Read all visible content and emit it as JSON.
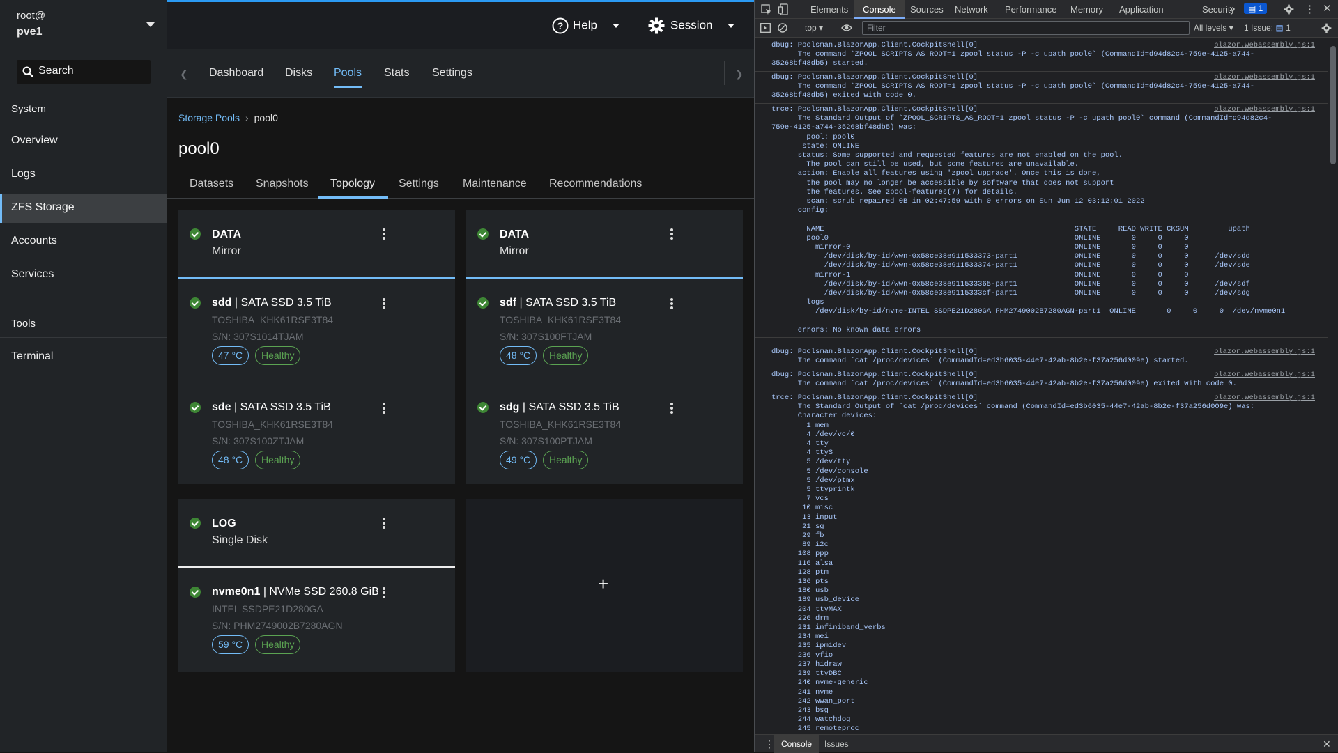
{
  "sidebar": {
    "user": "root@",
    "host": "pve1",
    "search_label": "Search",
    "system_heading": "System",
    "items": [
      {
        "label": "Overview"
      },
      {
        "label": "Logs"
      },
      {
        "label": "ZFS Storage",
        "active": true
      },
      {
        "label": "Accounts"
      },
      {
        "label": "Services"
      }
    ],
    "tools_heading": "Tools",
    "tools_items": [
      {
        "label": "Terminal"
      }
    ]
  },
  "masthead": {
    "help_label": "Help",
    "session_label": "Session"
  },
  "tabs": [
    "Dashboard",
    "Disks",
    "Pools",
    "Stats",
    "Settings"
  ],
  "active_tab": "Pools",
  "breadcrumb": {
    "parent": "Storage Pools",
    "current": "pool0"
  },
  "pool_title": "pool0",
  "subtabs": [
    "Datasets",
    "Snapshots",
    "Topology",
    "Settings",
    "Maintenance",
    "Recommendations"
  ],
  "active_subtab": "Topology",
  "topology": {
    "vdev_left": {
      "type": "DATA",
      "layout": "Mirror"
    },
    "vdev_right": {
      "type": "DATA",
      "layout": "Mirror"
    },
    "vdev_log": {
      "type": "LOG",
      "layout": "Single Disk"
    },
    "disks": {
      "sdd": {
        "name": "sdd",
        "desc": " | SATA SSD 3.5 TiB",
        "model": "TOSHIBA_KHK61RSE3T84",
        "serial": "S/N: 307S1014TJAM",
        "temp": "47 °C",
        "health": "Healthy"
      },
      "sdf": {
        "name": "sdf",
        "desc": " | SATA SSD 3.5 TiB",
        "model": "TOSHIBA_KHK61RSE3T84",
        "serial": "S/N: 307S100FTJAM",
        "temp": "48 °C",
        "health": "Healthy"
      },
      "sde": {
        "name": "sde",
        "desc": " | SATA SSD 3.5 TiB",
        "model": "TOSHIBA_KHK61RSE3T84",
        "serial": "S/N: 307S100ZTJAM",
        "temp": "48 °C",
        "health": "Healthy"
      },
      "sdg": {
        "name": "sdg",
        "desc": " | SATA SSD 3.5 TiB",
        "model": "TOSHIBA_KHK61RSE3T84",
        "serial": "S/N: 307S100PTJAM",
        "temp": "49 °C",
        "health": "Healthy"
      },
      "nvme": {
        "name": "nvme0n1",
        "desc": " | NVMe SSD 260.8 GiB",
        "model": "INTEL SSDPE21D280GA",
        "serial": "S/N: PHM2749002B7280AGN",
        "temp": "59 °C",
        "health": "Healthy"
      }
    },
    "add_label": "+"
  },
  "devtools": {
    "tabs": [
      "Elements",
      "Console",
      "Sources",
      "Network",
      "Performance",
      "Memory",
      "Application",
      "Security"
    ],
    "active_tab": "Console",
    "messages_badge": "1",
    "context": "top",
    "filter_placeholder": "Filter",
    "levels": "All levels",
    "issues": "1 Issue:",
    "issues_count": "1",
    "source_link": "blazor.webassembly.js:1",
    "logs": [
      "dbug: Poolsman.BlazorApp.Client.CockpitShell[0]\n      The command `ZPOOL_SCRIPTS_AS_ROOT=1 zpool status -P -c upath pool0` (CommandId=d94d82c4-759e-4125-a744-\n35268bf48db5) started.",
      "dbug: Poolsman.BlazorApp.Client.CockpitShell[0]\n      The command `ZPOOL_SCRIPTS_AS_ROOT=1 zpool status -P -c upath pool0` (CommandId=d94d82c4-759e-4125-a744-\n35268bf48db5) exited with code 0.",
      "trce: Poolsman.BlazorApp.Client.CockpitShell[0]\n      The Standard Output of `ZPOOL_SCRIPTS_AS_ROOT=1 zpool status -P -c upath pool0` command (CommandId=d94d82c4-\n759e-4125-a744-35268bf48db5) was:\n        pool: pool0\n       state: ONLINE\n      status: Some supported and requested features are not enabled on the pool.\n        The pool can still be used, but some features are unavailable.\n      action: Enable all features using 'zpool upgrade'. Once this is done,\n        the pool may no longer be accessible by software that does not support\n        the features. See zpool-features(7) for details.\n        scan: scrub repaired 0B in 02:47:59 with 0 errors on Sun Jun 12 03:12:01 2022\n      config:\n\n        NAME                                                         STATE     READ WRITE CKSUM         upath\n        pool0                                                        ONLINE       0     0     0\n          mirror-0                                                   ONLINE       0     0     0\n            /dev/disk/by-id/wwn-0x58ce38e911533373-part1             ONLINE       0     0     0      /dev/sdd\n            /dev/disk/by-id/wwn-0x58ce38e911533374-part1             ONLINE       0     0     0      /dev/sde\n          mirror-1                                                   ONLINE       0     0     0\n            /dev/disk/by-id/wwn-0x58ce38e911533365-part1             ONLINE       0     0     0      /dev/sdf\n            /dev/disk/by-id/wwn-0x58ce38e9115333cf-part1             ONLINE       0     0     0      /dev/sdg\n        logs\n          /dev/disk/by-id/nvme-INTEL_SSDPE21D280GA_PHM2749002B7280AGN-part1  ONLINE       0     0     0  /dev/nvme0n1\n\n      errors: No known data errors\n",
      "dbug: Poolsman.BlazorApp.Client.CockpitShell[0]\n      The command `cat /proc/devices` (CommandId=ed3b6035-44e7-42ab-8b2e-f37a256d009e) started.",
      "dbug: Poolsman.BlazorApp.Client.CockpitShell[0]\n      The command `cat /proc/devices` (CommandId=ed3b6035-44e7-42ab-8b2e-f37a256d009e) exited with code 0.",
      "trce: Poolsman.BlazorApp.Client.CockpitShell[0]\n      The Standard Output of `cat /proc/devices` command (CommandId=ed3b6035-44e7-42ab-8b2e-f37a256d009e) was:\n      Character devices:\n        1 mem\n        4 /dev/vc/0\n        4 tty\n        4 ttyS\n        5 /dev/tty\n        5 /dev/console\n        5 /dev/ptmx\n        5 ttyprintk\n        7 vcs\n       10 misc\n       13 input\n       21 sg\n       29 fb\n       89 i2c\n      108 ppp\n      116 alsa\n      128 ptm\n      136 pts\n      180 usb\n      189 usb_device\n      204 ttyMAX\n      226 drm\n      231 infiniband_verbs\n      234 mei\n      235 ipmidev\n      236 vfio\n      237 hidraw\n      239 ttyDBC\n      240 nvme-generic\n      241 nvme\n      242 wwan_port\n      243 bsg\n      244 watchdog\n      245 remoteproc"
    ],
    "drawer_tabs": [
      "Console",
      "Issues"
    ]
  }
}
